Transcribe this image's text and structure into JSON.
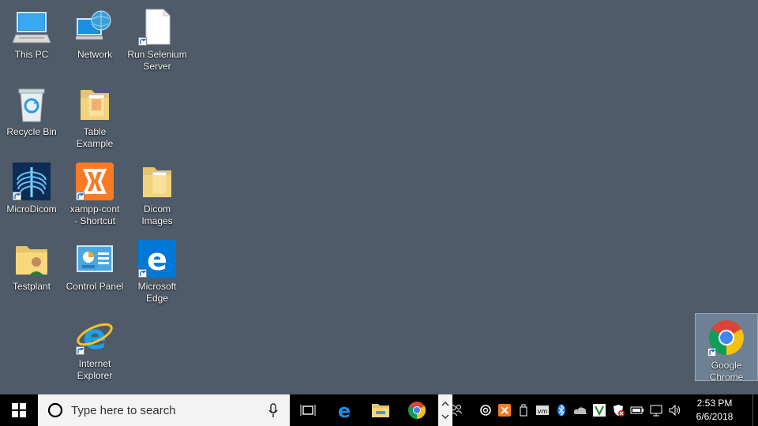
{
  "desktop_icons": {
    "this_pc": "This PC",
    "network": "Network",
    "run_selenium": "Run Selenium\nServer",
    "recycle_bin": "Recycle Bin",
    "table_example": "Table Example",
    "microdicom": "MicroDicom",
    "xampp": "xampp-cont\n- Shortcut",
    "dicom_images": "Dicom Images",
    "testplant": "Testplant",
    "control_panel": "Control Panel",
    "edge": "Microsoft\nEdge",
    "ie": "Internet\nExplorer",
    "chrome": "Google\nChrome"
  },
  "taskbar": {
    "search_placeholder": "Type here to search",
    "clock_time": "2:53 PM",
    "clock_date": "6/6/2018"
  },
  "colors": {
    "desktop_bg": "#4f5b69",
    "taskbar_bg": "#000000",
    "accent": "#0078d7"
  }
}
